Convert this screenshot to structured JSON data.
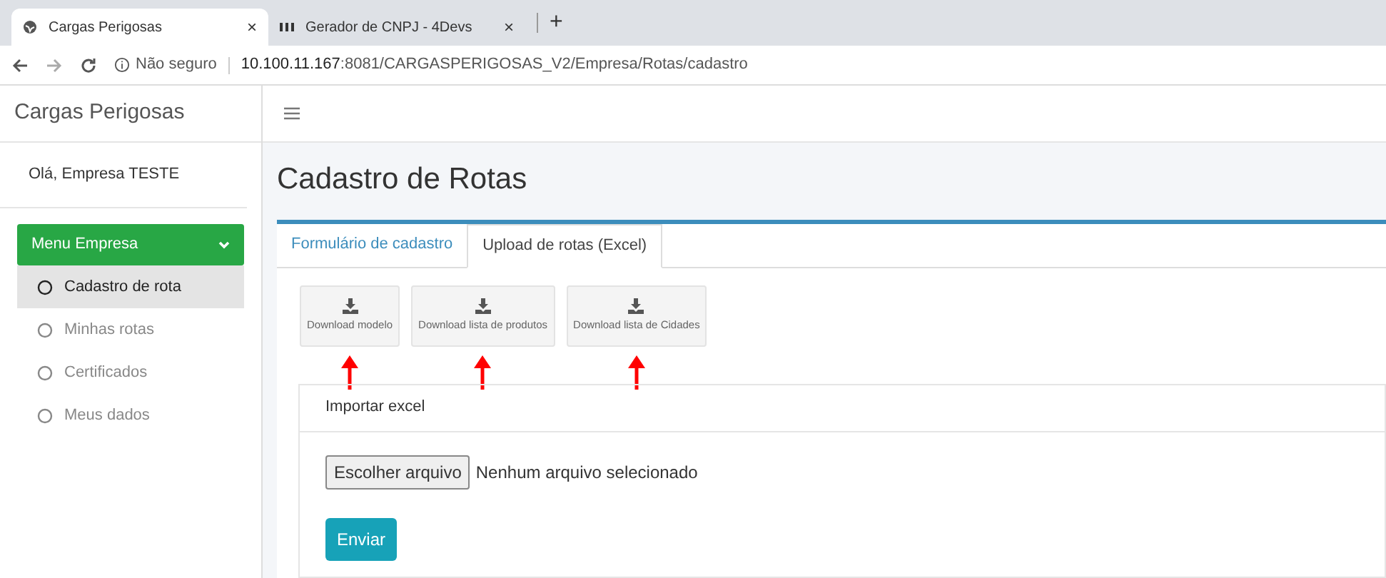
{
  "browser": {
    "tabs": [
      {
        "title": "Cargas Perigosas",
        "selected": true,
        "close": "×"
      },
      {
        "title": "Gerador de CNPJ - 4Devs",
        "selected": false,
        "close": "×"
      }
    ],
    "new_tab": "+",
    "security": "Não seguro",
    "url_host": "10.100.11.167",
    "url_rest": ":8081/CARGASPERIGOSAS_V2/Empresa/Rotas/cadastro"
  },
  "sidebar": {
    "brand": "Cargas Perigosas",
    "greeting": "Olá, Empresa TESTE",
    "menu": {
      "label": "Menu Empresa",
      "expanded": true,
      "items": [
        {
          "label": "Cadastro de rota",
          "selected": true
        },
        {
          "label": "Minhas rotas",
          "selected": false
        },
        {
          "label": "Certificados",
          "selected": false
        },
        {
          "label": "Meus dados",
          "selected": false
        }
      ]
    }
  },
  "page": {
    "title": "Cadastro de Rotas",
    "tabs": [
      {
        "label": "Formulário de cadastro",
        "selected": false
      },
      {
        "label": "Upload de rotas (Excel)",
        "selected": true
      }
    ],
    "downloads": [
      "Download modelo",
      "Download lista de produtos",
      "Download lista de Cidades"
    ],
    "import": {
      "title": "Importar excel",
      "file_button": "Escolher arquivo",
      "file_status": "Nenhum arquivo selecionado",
      "submit": "Enviar"
    }
  }
}
